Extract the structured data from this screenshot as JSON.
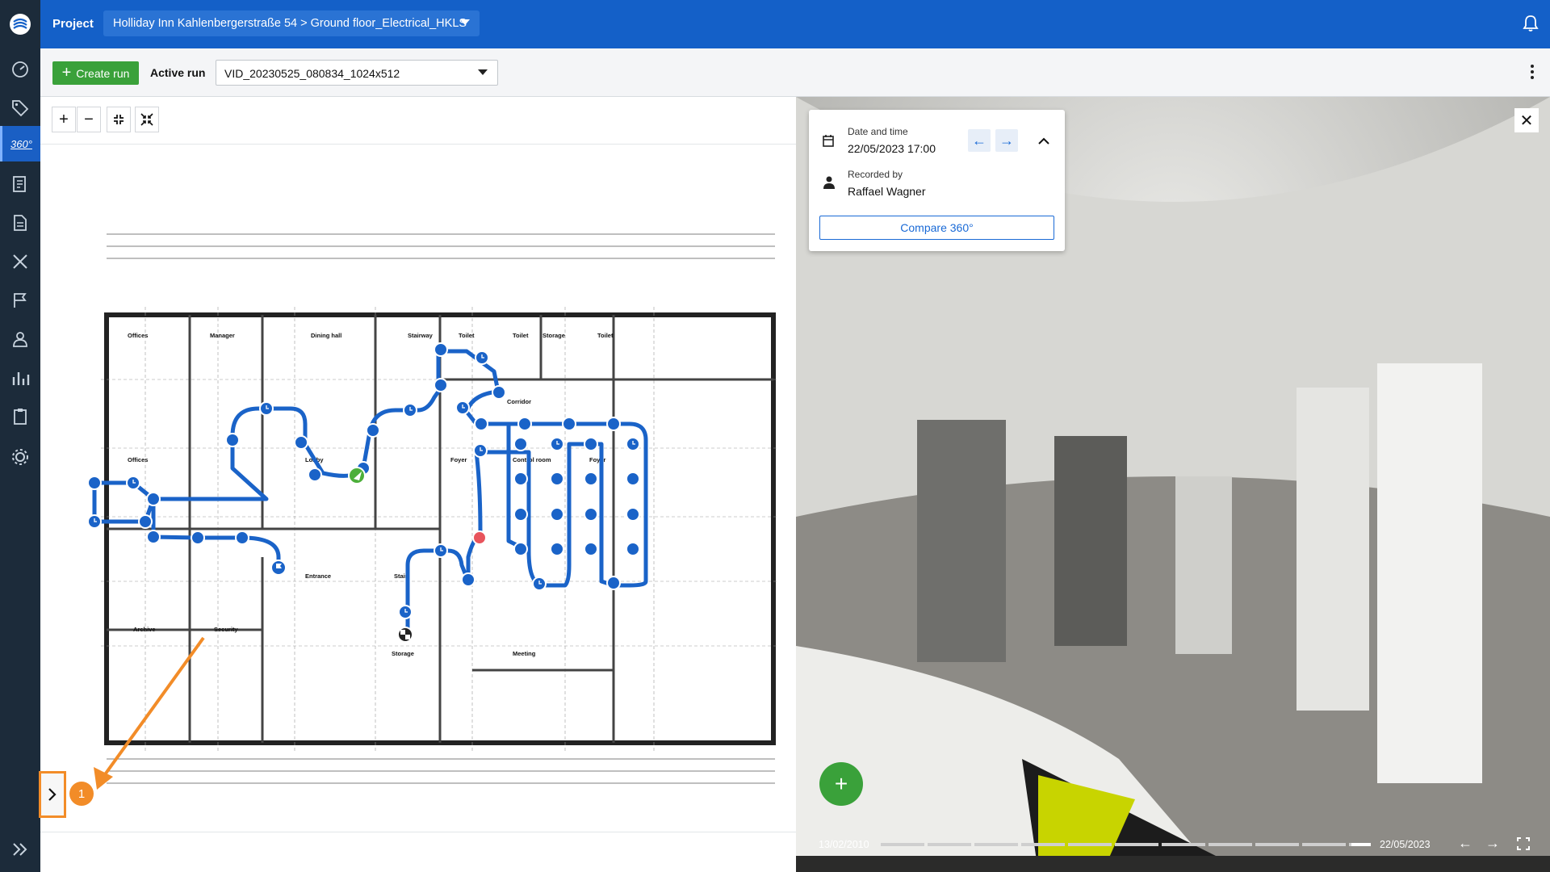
{
  "sidebar": {
    "logo": "app-logo",
    "items": [
      {
        "icon": "dashboard-icon"
      },
      {
        "icon": "tag-icon"
      },
      {
        "icon": "360-icon",
        "label": "360°",
        "active": true
      },
      {
        "icon": "documents-icon"
      },
      {
        "icon": "file-icon"
      },
      {
        "icon": "tools-icon"
      },
      {
        "icon": "flag-icon"
      },
      {
        "icon": "user-icon"
      },
      {
        "icon": "chart-icon"
      },
      {
        "icon": "clipboard-icon"
      },
      {
        "icon": "settings-icon"
      }
    ],
    "collapse_icon": "double-chevron-right-icon"
  },
  "topbar": {
    "project_label": "Project",
    "project_value": "Holliday Inn Kahlenbergerstraße 54 > Ground floor_Electrical_HKLS",
    "bell_icon": "bell-icon"
  },
  "toolbar": {
    "create_run": "Create run",
    "active_run_label": "Active run",
    "active_run_value": "VID_20230525_080834_1024x512"
  },
  "map": {
    "zoom_in": "+",
    "zoom_out": "−",
    "rooms": [
      "Offices",
      "Manager",
      "Dining hall",
      "Stairway",
      "Toilet",
      "Toilet",
      "Storage",
      "Toilet",
      "Corridor",
      "Offices",
      "Lobby",
      "Foyer",
      "Control room",
      "Foyer",
      "Entrance",
      "Stair",
      "Archive",
      "Security",
      "Storage",
      "Meeting"
    ],
    "step_badge": "1"
  },
  "viewer": {
    "date_label": "Date and time",
    "date_value": "22/05/2023 17:00",
    "recorded_label": "Recorded by",
    "recorded_value": "Raffael Wagner",
    "compare_button": "Compare 360°",
    "timeline_start": "13/02/2010",
    "timeline_end": "22/05/2023"
  },
  "colors": {
    "primary": "#1460c8",
    "sidebar": "#1c2b3a",
    "green": "#3aa13a",
    "path": "#1a63c8",
    "annotation": "#f28c28"
  }
}
